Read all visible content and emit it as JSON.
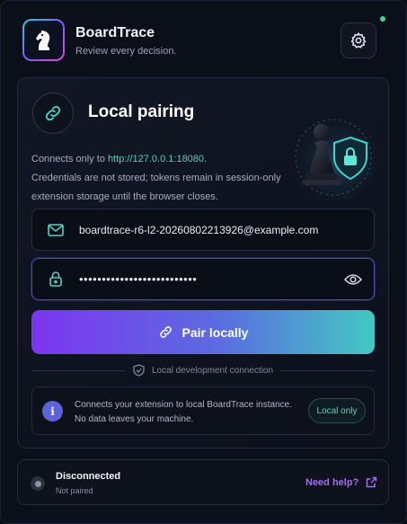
{
  "app": {
    "title": "BoardTrace",
    "subtitle": "Review every decision."
  },
  "card": {
    "title": "Local pairing",
    "desc_prefix": "Connects only to ",
    "url": "http://127.0.0.1:18080",
    "desc_suffix": ".",
    "desc_line2": "Credentials are not stored; tokens remain in session-only",
    "desc_line3": "extension storage until the browser closes."
  },
  "form": {
    "email_value": "boardtrace-r6-l2-20260802213926@example.com",
    "password_mask": "••••••••••••••••••••••••••"
  },
  "pair_button": {
    "label": "Pair locally"
  },
  "divider": {
    "label": "Local development connection"
  },
  "info": {
    "line1": "Connects your extension to local BoardTrace instance.",
    "line2": "No data leaves your machine.",
    "badge": "Local only"
  },
  "footer": {
    "status": "Disconnected",
    "substatus": "Not paired",
    "help_label": "Need help?"
  },
  "icons": {
    "logo": "chess-knight-icon",
    "settings": "gear-icon",
    "link": "link-icon",
    "email": "mail-icon",
    "password": "lock-icon",
    "reveal": "eye-icon",
    "shield": "shield-check-icon",
    "info": "info-icon",
    "external": "external-link-icon"
  },
  "colors": {
    "accent_purple": "#7d35f0",
    "accent_teal": "#43c9c2",
    "online": "#3ddc84",
    "link": "#4fd1c5"
  }
}
